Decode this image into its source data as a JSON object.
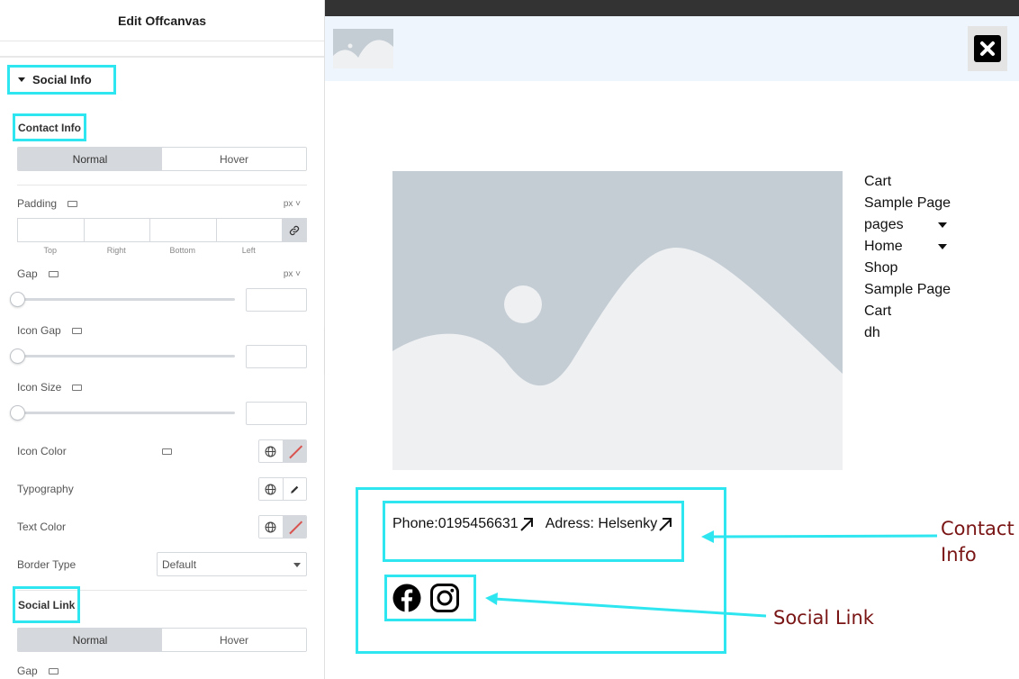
{
  "panel": {
    "title": "Edit Offcanvas",
    "section_title": "Social Info",
    "contact_info": {
      "heading": "Contact Info",
      "tabs": [
        "Normal",
        "Hover"
      ],
      "padding_label": "Padding",
      "padding_unit": "px",
      "padding_sides": [
        "Top",
        "Right",
        "Bottom",
        "Left"
      ],
      "gap_label": "Gap",
      "gap_unit": "px",
      "icon_gap_label": "Icon Gap",
      "icon_size_label": "Icon Size",
      "icon_color_label": "Icon Color",
      "typography_label": "Typography",
      "text_color_label": "Text Color",
      "border_type_label": "Border Type",
      "border_type_value": "Default"
    },
    "social_link": {
      "heading": "Social Link",
      "tabs": [
        "Normal",
        "Hover"
      ],
      "gap_label": "Gap"
    }
  },
  "preview": {
    "menu": [
      {
        "label": "Cart",
        "dropdown": false
      },
      {
        "label": "Sample Page",
        "dropdown": false
      },
      {
        "label": "pages",
        "dropdown": true
      },
      {
        "label": "Home",
        "dropdown": true
      },
      {
        "label": "Shop",
        "dropdown": false
      },
      {
        "label": "Sample Page",
        "dropdown": false
      },
      {
        "label": "Cart",
        "dropdown": false
      },
      {
        "label": "dh",
        "dropdown": false
      }
    ],
    "contact": {
      "phone": "Phone:0195456631",
      "address": "Adress: Helsenky"
    },
    "social_icons": [
      "facebook-icon",
      "instagram-icon"
    ]
  },
  "annotations": {
    "contact_line1": "Contact",
    "contact_line2": "Info",
    "social": "Social Link"
  },
  "colors": {
    "highlight": "#2ee6f0",
    "annotation": "#7a1515",
    "offcanvas_header_bg": "#eef5fc",
    "placeholder": "#c4ccd4"
  }
}
